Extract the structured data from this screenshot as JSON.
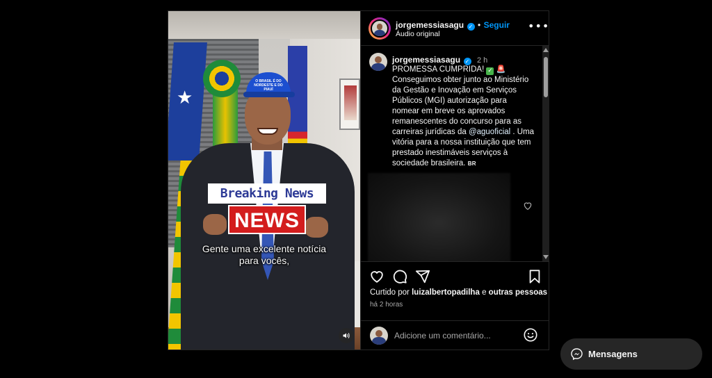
{
  "post": {
    "username": "jorgemessiasagu",
    "follow_label": "Seguir",
    "bullet": "•",
    "audio_label": "Áudio original",
    "time_ago": "2 h",
    "caption_lines": {
      "line1": "PROMESSA CUMPRIDA!",
      "body": "Conseguimos obter junto ao Ministério da Gestão e Inovação em Serviços Públicos (MGI) autorização para nomear em breve os aprovados remanescentes do concurso para as carreiras jurídicas da",
      "mention": "@aguoficial",
      "tail": ". Uma vitória para a nossa instituição que tem prestado inestimáveis serviços à sociedade brasileira.",
      "flag_tag": "BR"
    }
  },
  "video": {
    "breaking_news_label": "Breaking News",
    "news_label": "NEWS",
    "subtitle_line1": "Gente uma excelente notícia",
    "subtitle_line2": "para vocês,",
    "cap_text": "O BRASIL É DO NORDESTE E DO PIAUÍ"
  },
  "engagement": {
    "liked_prefix": "Curtido por",
    "liked_user": "luizalbertopadilha",
    "liked_conj": "e",
    "liked_others": "outras pessoas",
    "time_label": "há 2 horas"
  },
  "comment_box": {
    "placeholder": "Adicione um comentário..."
  },
  "messages": {
    "label": "Mensagens"
  },
  "icons": {
    "verified": "verified-badge-icon",
    "more": "more-options-icon",
    "like": "heart-icon",
    "comment": "comment-icon",
    "share": "share-icon",
    "save": "bookmark-icon",
    "emoji": "emoji-icon",
    "mute": "speaker-icon",
    "messenger": "messenger-icon"
  },
  "colors": {
    "background": "#000000",
    "panel_border": "#262626",
    "link_blue": "#0095f6",
    "secondary_text": "#a8a8a8",
    "news_red": "#d31d1d"
  }
}
